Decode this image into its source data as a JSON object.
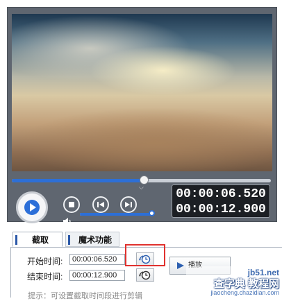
{
  "player": {
    "progress_fraction": 0.51,
    "volume_fraction": 1.0,
    "current_time": "00:00:06.520",
    "total_time": "00:00:12.900"
  },
  "tabs": [
    {
      "label": "截取"
    },
    {
      "label": "魔术功能"
    }
  ],
  "trim": {
    "start_label": "开始时间:",
    "start_value": "00:00:06.520",
    "end_label": "结束时间:",
    "end_value": "00:00:12.900"
  },
  "preview_button": {
    "label": "播放"
  },
  "hint_text": "提示：可设置截取时间段进行剪辑",
  "watermark": {
    "site": "jb51.net",
    "brand": "查字典 教程网",
    "url": "jiaocheng.chazidian.com"
  },
  "colors": {
    "accent": "#2d6fd6",
    "highlight": "#e0312e",
    "player_bg": "#5f6670"
  },
  "icons": {
    "play": "play-icon",
    "stop": "stop-icon",
    "prev": "prev-frame-icon",
    "next": "next-frame-icon",
    "volume": "speaker-icon",
    "clock": "clock-icon"
  }
}
